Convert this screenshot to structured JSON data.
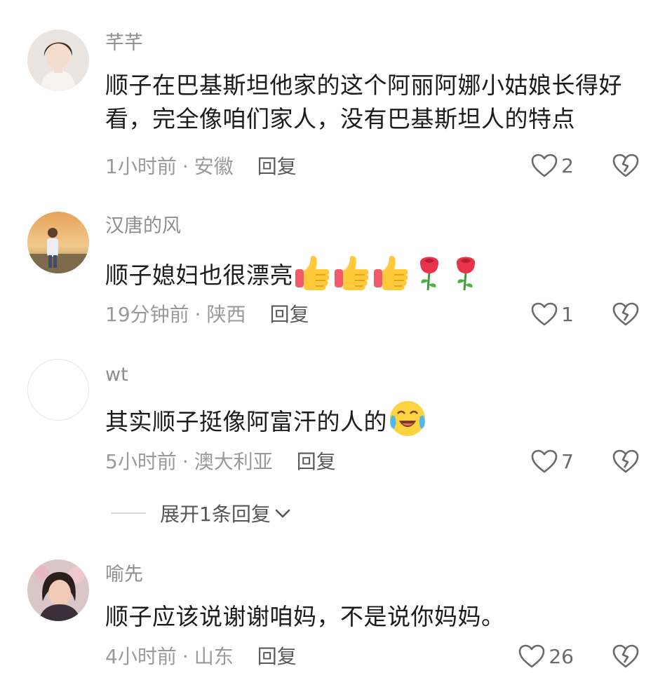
{
  "comments": [
    {
      "username": "芊芊",
      "content": "顺子在巴基斯坦他家的这个阿丽阿娜小姑娘长得好看，完全像咱们家人，没有巴基斯坦人的特点",
      "time": "1小时前",
      "location": "安徽",
      "reply_label": "回复",
      "likes": "2"
    },
    {
      "username": "汉唐的风",
      "content": "顺子媳妇也很漂亮",
      "emojis": [
        "thumbs-up",
        "thumbs-up",
        "thumbs-up",
        "rose",
        "rose"
      ],
      "time": "19分钟前",
      "location": "陕西",
      "reply_label": "回复",
      "likes": "1"
    },
    {
      "username": "wt",
      "content": "其实顺子挺像阿富汗的人的",
      "emojis": [
        "crying-laughing"
      ],
      "time": "5小时前",
      "location": "澳大利亚",
      "reply_label": "回复",
      "likes": "7",
      "expand_label": "展开1条回复"
    },
    {
      "username": "喻先",
      "content": "顺子应该说谢谢咱妈，不是说你妈妈。",
      "time": "4小时前",
      "location": "山东",
      "reply_label": "回复",
      "likes": "26"
    }
  ],
  "separator": "·",
  "colors": {
    "username": "#8e8e8e",
    "content": "#1c1c1c",
    "meta": "#9a9a9a",
    "icon": "#6a6a6a"
  }
}
